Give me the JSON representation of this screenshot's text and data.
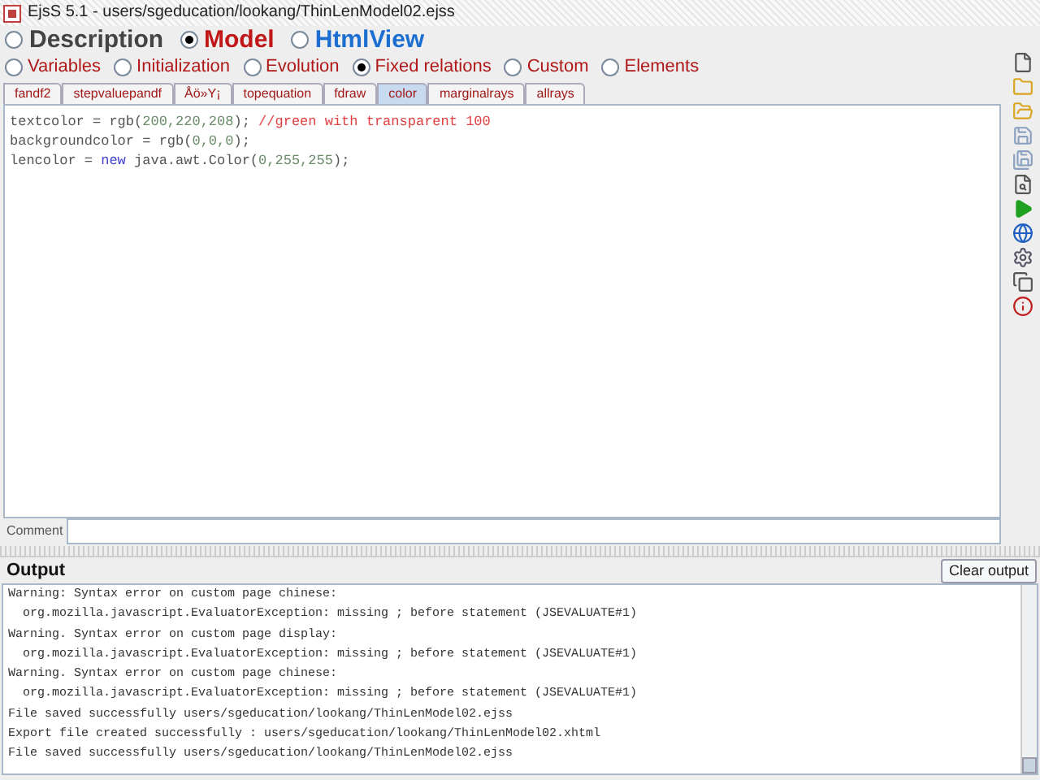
{
  "window": {
    "title": "EjsS 5.1 - users/sgeducation/lookang/ThinLenModel02.ejss"
  },
  "main_tabs": [
    {
      "label": "Description",
      "selected": false
    },
    {
      "label": "Model",
      "selected": true
    },
    {
      "label": "HtmlView",
      "selected": false
    }
  ],
  "model_tabs": [
    {
      "label": "Variables",
      "selected": false
    },
    {
      "label": "Initialization",
      "selected": false
    },
    {
      "label": "Evolution",
      "selected": false
    },
    {
      "label": "Fixed relations",
      "selected": true
    },
    {
      "label": "Custom",
      "selected": false
    },
    {
      "label": "Elements",
      "selected": false
    }
  ],
  "page_tabs": [
    {
      "label": "fandf2",
      "selected": false
    },
    {
      "label": "stepvaluepandf",
      "selected": false
    },
    {
      "label": "Åö»Y¡",
      "selected": false
    },
    {
      "label": "topequation",
      "selected": false
    },
    {
      "label": "fdraw",
      "selected": false
    },
    {
      "label": "color",
      "selected": true
    },
    {
      "label": "marginalrays",
      "selected": false
    },
    {
      "label": "allrays",
      "selected": false
    }
  ],
  "code_lines": [
    [
      {
        "kind": "plain",
        "text": "textcolor = rgb("
      },
      {
        "kind": "number",
        "text": "200,220,208"
      },
      {
        "kind": "plain",
        "text": "); "
      },
      {
        "kind": "comment",
        "text": "//green with transparent 100"
      }
    ],
    [
      {
        "kind": "plain",
        "text": "backgroundcolor = rgb("
      },
      {
        "kind": "number",
        "text": "0,0,0"
      },
      {
        "kind": "plain",
        "text": ");"
      }
    ],
    [
      {
        "kind": "plain",
        "text": "lencolor = "
      },
      {
        "kind": "keyword",
        "text": "new"
      },
      {
        "kind": "plain",
        "text": " java.awt.Color("
      },
      {
        "kind": "number",
        "text": "0,255,255"
      },
      {
        "kind": "plain",
        "text": ");"
      }
    ]
  ],
  "comment": {
    "label": "Comment"
  },
  "output": {
    "title": "Output",
    "clear_button": "Clear output",
    "lines": [
      "Warning: Syntax error on custom page chinese:",
      "  org.mozilla.javascript.EvaluatorException: missing ; before statement (JSEVALUATE#1)",
      "Warning. Syntax error on custom page display:",
      "  org.mozilla.javascript.EvaluatorException: missing ; before statement (JSEVALUATE#1)",
      "Warning. Syntax error on custom page chinese:",
      "  org.mozilla.javascript.EvaluatorException: missing ; before statement (JSEVALUATE#1)",
      "File saved successfully users/sgeducation/lookang/ThinLenModel02.ejss",
      "Export file created successfully : users/sgeducation/lookang/ThinLenModel02.xhtml",
      "File saved successfully users/sgeducation/lookang/ThinLenModel02.ejss"
    ]
  }
}
